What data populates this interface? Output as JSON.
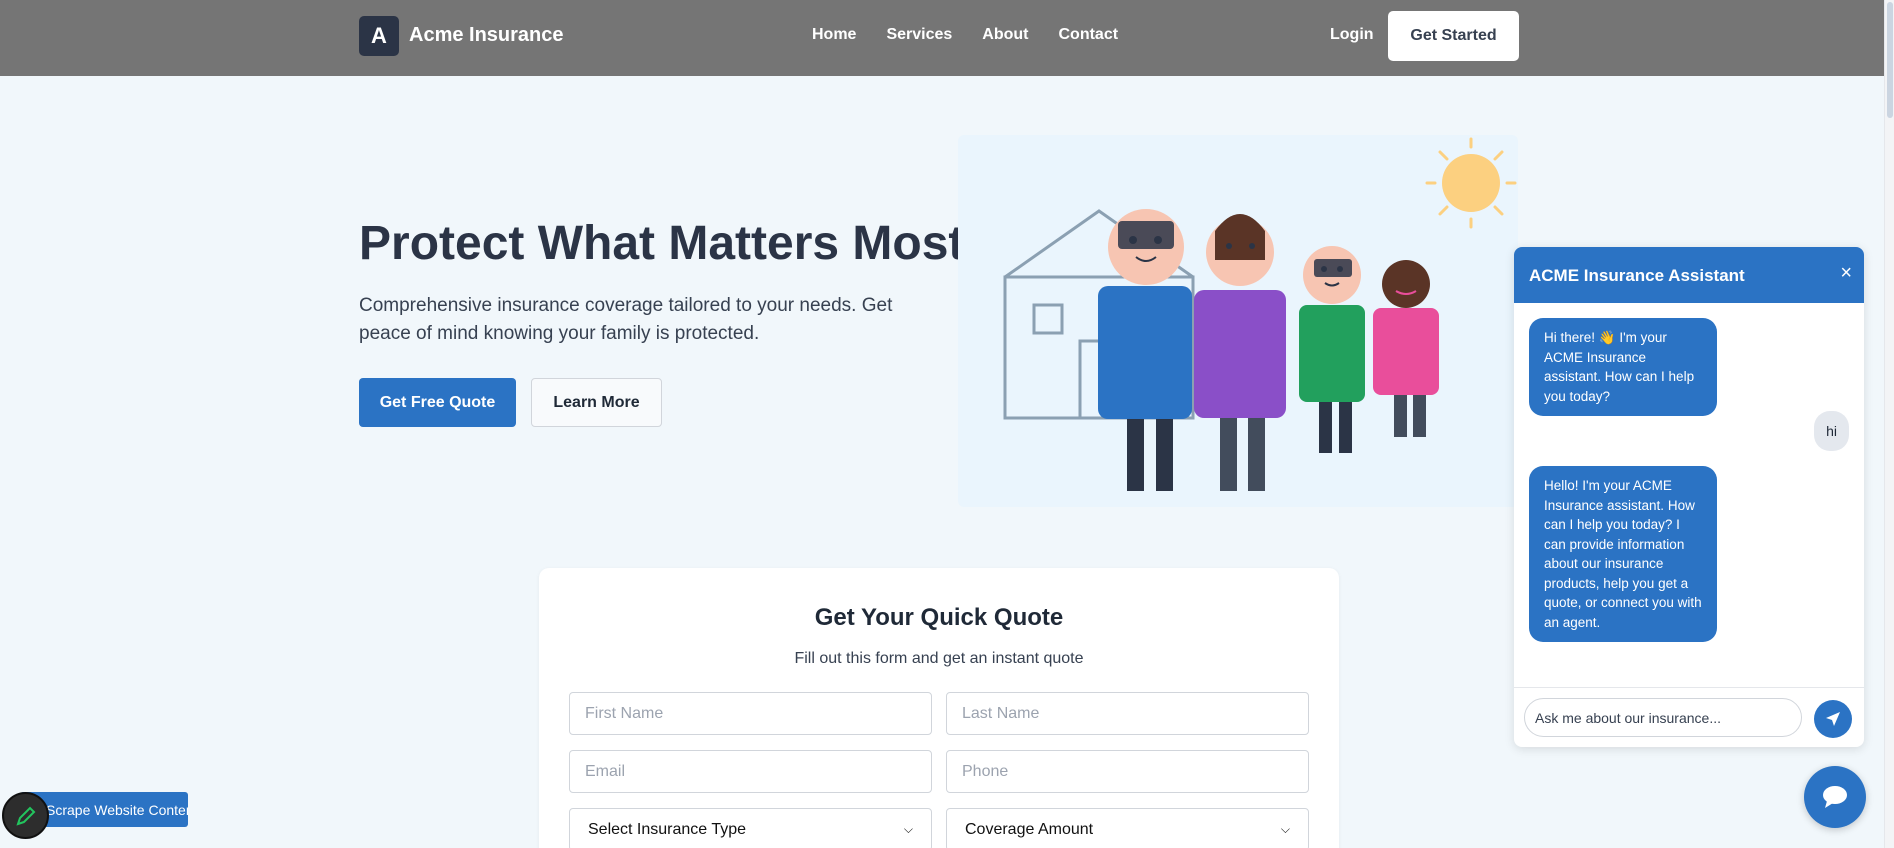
{
  "navbar": {
    "logo_letter": "A",
    "brand": "Acme Insurance",
    "links": [
      "Home",
      "Services",
      "About",
      "Contact"
    ],
    "login": "Login",
    "get_started": "Get Started"
  },
  "hero": {
    "title": "Protect What Matters Most",
    "subtitle": "Comprehensive insurance coverage tailored to your needs. Get peace of mind knowing your family is protected.",
    "primary_button": "Get Free Quote",
    "secondary_button": "Learn More"
  },
  "quote": {
    "title": "Get Your Quick Quote",
    "subtitle": "Fill out this form and get an instant quote",
    "first_name_placeholder": "First Name",
    "last_name_placeholder": "Last Name",
    "email_placeholder": "Email",
    "phone_placeholder": "Phone",
    "insurance_type": "Select Insurance Type",
    "coverage_amount": "Coverage Amount"
  },
  "chat": {
    "title": "ACME Insurance Assistant",
    "close": "×",
    "messages": [
      {
        "from": "bot",
        "text": "Hi there! 👋 I'm your ACME Insurance assistant. How can I help you today?"
      },
      {
        "from": "user",
        "text": "hi"
      },
      {
        "from": "bot",
        "text": "Hello! I'm your ACME Insurance assistant. How can I help you today? I can provide information about our insurance products, help you get a quote, or connect you with an agent."
      }
    ],
    "input_placeholder": "Ask me about our insurance..."
  },
  "scrape_button": "Scrape Website Content",
  "icons": {
    "send": "send-icon",
    "chat_fab": "chat-bubble-icon",
    "scrape": "pencil-icon"
  },
  "colors": {
    "primary": "#2b73c4",
    "navbar": "#757575",
    "background": "#f1f7fb"
  }
}
